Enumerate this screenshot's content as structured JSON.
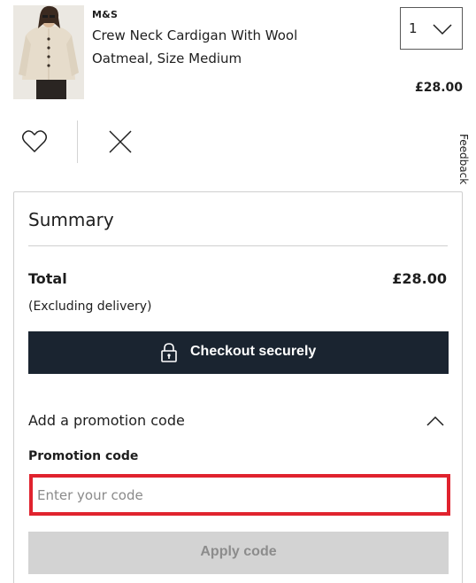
{
  "product": {
    "brand": "M&S",
    "name": "Crew Neck Cardigan With Wool",
    "variant": "Oatmeal, Size Medium",
    "quantity": "1",
    "price": "£28.00",
    "image_icon": "cardigan-photo"
  },
  "actions": {
    "wishlist_icon": "heart-icon",
    "remove_icon": "close-icon"
  },
  "feedback": {
    "label": "Feedback"
  },
  "summary": {
    "title": "Summary",
    "total_label": "Total",
    "total_value": "£28.00",
    "excluding_delivery": "(Excluding delivery)",
    "checkout_label": "Checkout securely",
    "promo_toggle_label": "Add a promotion code",
    "promo_field_label": "Promotion code",
    "promo_placeholder": "Enter your code",
    "promo_value": "",
    "apply_label": "Apply code"
  },
  "colors": {
    "checkout_bg": "#1a2430",
    "focus_outline": "#e0232e",
    "disabled_bg": "#d3d3d3"
  }
}
